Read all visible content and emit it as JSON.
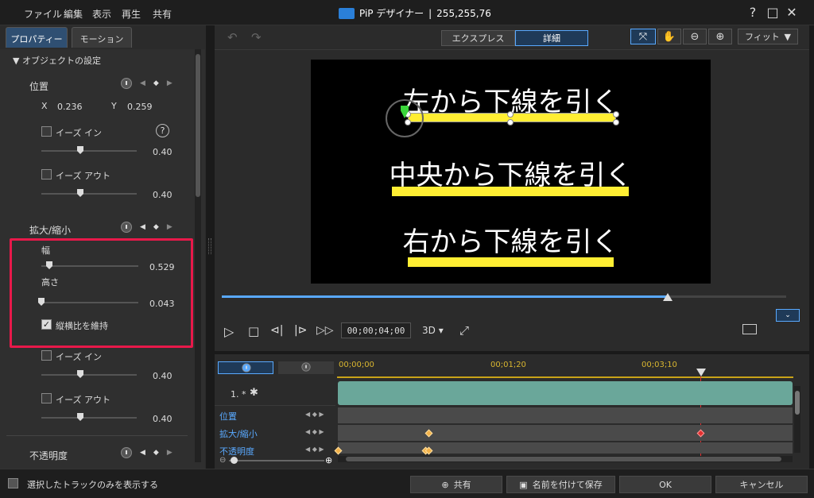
{
  "menu": [
    "ファイル",
    "編集",
    "表示",
    "再生",
    "共有"
  ],
  "app": {
    "title": "PiP デザイナー",
    "separator": "|",
    "rgb": "255,255,76"
  },
  "window_buttons": [
    "?",
    "□",
    "✕"
  ],
  "left_tabs": [
    "プロパティー",
    "モーション"
  ],
  "props": {
    "section": "オブジェクトの設定",
    "position": {
      "label": "位置",
      "x_label": "X",
      "x": "0.236",
      "y_label": "Y",
      "y": "0.259"
    },
    "ease_in_1": {
      "label": "イーズ イン",
      "value": "0.40",
      "level": 0.38
    },
    "ease_out_1": {
      "label": "イーズ アウト",
      "value": "0.40",
      "level": 0.38
    },
    "scale": {
      "label": "拡大/縮小",
      "width_label": "幅",
      "width": "0.529",
      "width_level": 0.08,
      "height_label": "高さ",
      "height": "0.043",
      "height_level": 0.01
    },
    "keep_ratio": "縦横比を維持",
    "ease_in_2": {
      "label": "イーズ イン",
      "value": "0.40",
      "level": 0.38
    },
    "ease_out_2": {
      "label": "イーズ アウト",
      "value": "0.40",
      "level": 0.38
    },
    "opacity": "不透明度",
    "help_glyph": "?"
  },
  "preview": {
    "mode_express": "エクスプレス",
    "mode_detail": "詳細",
    "fit": "フィット",
    "captions": [
      "左から下線を引く",
      "中央から下線を引く",
      "右から下線を引く"
    ],
    "timecode": "00;00;04;00",
    "three_d": "3D",
    "progress": 0.79
  },
  "timeline": {
    "ruler": [
      "00;00;00",
      "00;01;20",
      "00;03;10"
    ],
    "track1": "1. *",
    "rows": [
      "位置",
      "拡大/縮小",
      "不透明度"
    ]
  },
  "bottom": {
    "only_selected": "選択したトラックのみを表示する",
    "share": "共有",
    "save_as": "名前を付けて保存",
    "ok": "OK",
    "cancel": "キャンセル"
  },
  "colors": {
    "accent": "#59a9ff",
    "highlight": "#e8194a",
    "underline": "#ffee33",
    "track": "#6aa79a"
  }
}
